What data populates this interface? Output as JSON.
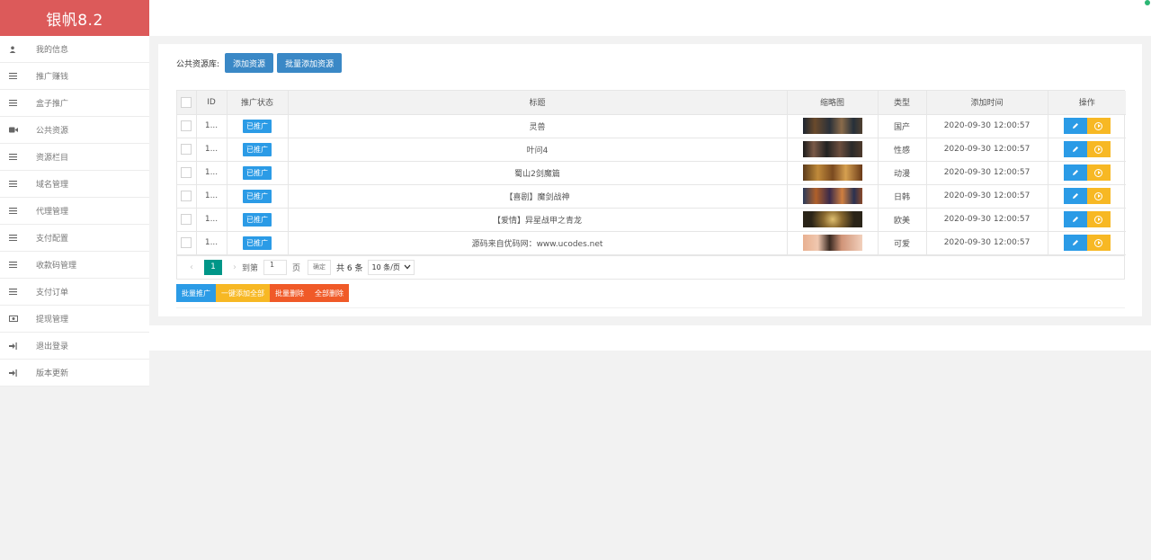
{
  "app": {
    "brand": "银帆8.2"
  },
  "sidebar": {
    "items": [
      {
        "label": "我的信息",
        "icon": "user-icon"
      },
      {
        "label": "推广赚钱",
        "icon": "list-icon"
      },
      {
        "label": "盒子推广",
        "icon": "list-icon"
      },
      {
        "label": "公共资源",
        "icon": "video-icon"
      },
      {
        "label": "资源栏目",
        "icon": "list-icon"
      },
      {
        "label": "域名管理",
        "icon": "list-icon"
      },
      {
        "label": "代理管理",
        "icon": "list-icon"
      },
      {
        "label": "支付配置",
        "icon": "list-icon"
      },
      {
        "label": "收款码管理",
        "icon": "list-icon"
      },
      {
        "label": "支付订单",
        "icon": "list-icon"
      },
      {
        "label": "提现管理",
        "icon": "money-icon"
      },
      {
        "label": "退出登录",
        "icon": "signout-icon"
      },
      {
        "label": "版本更新",
        "icon": "signout-icon"
      }
    ]
  },
  "toolbar": {
    "label": "公共资源库:",
    "add_label": "添加资源",
    "batch_add_label": "批量添加资源"
  },
  "table": {
    "headers": {
      "id": "ID",
      "status": "推广状态",
      "title": "标题",
      "thumb": "缩略图",
      "type": "类型",
      "time": "添加时间",
      "ops": "操作"
    },
    "rows": [
      {
        "id": "1...",
        "status": "已推广",
        "title": "灵兽",
        "type": "国产",
        "time": "2020-09-30 12:00:57"
      },
      {
        "id": "1...",
        "status": "已推广",
        "title": "叶问4",
        "type": "性感",
        "time": "2020-09-30 12:00:57"
      },
      {
        "id": "1...",
        "status": "已推广",
        "title": "蜀山2剑魔篇",
        "type": "动漫",
        "time": "2020-09-30 12:00:57"
      },
      {
        "id": "1...",
        "status": "已推广",
        "title": "【喜剧】魔剑战神",
        "type": "日韩",
        "time": "2020-09-30 12:00:57"
      },
      {
        "id": "1...",
        "status": "已推广",
        "title": "【爱情】异星战甲之青龙",
        "type": "欧美",
        "time": "2020-09-30 12:00:57"
      },
      {
        "id": "1...",
        "status": "已推广",
        "title": "源码来自优码网：www.ucodes.net",
        "type": "可爱",
        "time": "2020-09-30 12:00:57"
      }
    ]
  },
  "pager": {
    "current": "1",
    "goto_label": "到第",
    "input_value": "1",
    "page_unit": "页",
    "confirm_label": "确定",
    "total": "共 6 条",
    "page_size": "10 条/页"
  },
  "bulk": {
    "promote": "批量推广",
    "add_all": "一键添加全部",
    "delete": "批量删除",
    "delete_all": "全部删除"
  },
  "colors": {
    "brand": "#dc5a5a",
    "primary": "#3a88c6",
    "tag": "#2b9be6",
    "warn": "#f7b824",
    "danger": "#f05a28",
    "pager_current": "#009688"
  }
}
